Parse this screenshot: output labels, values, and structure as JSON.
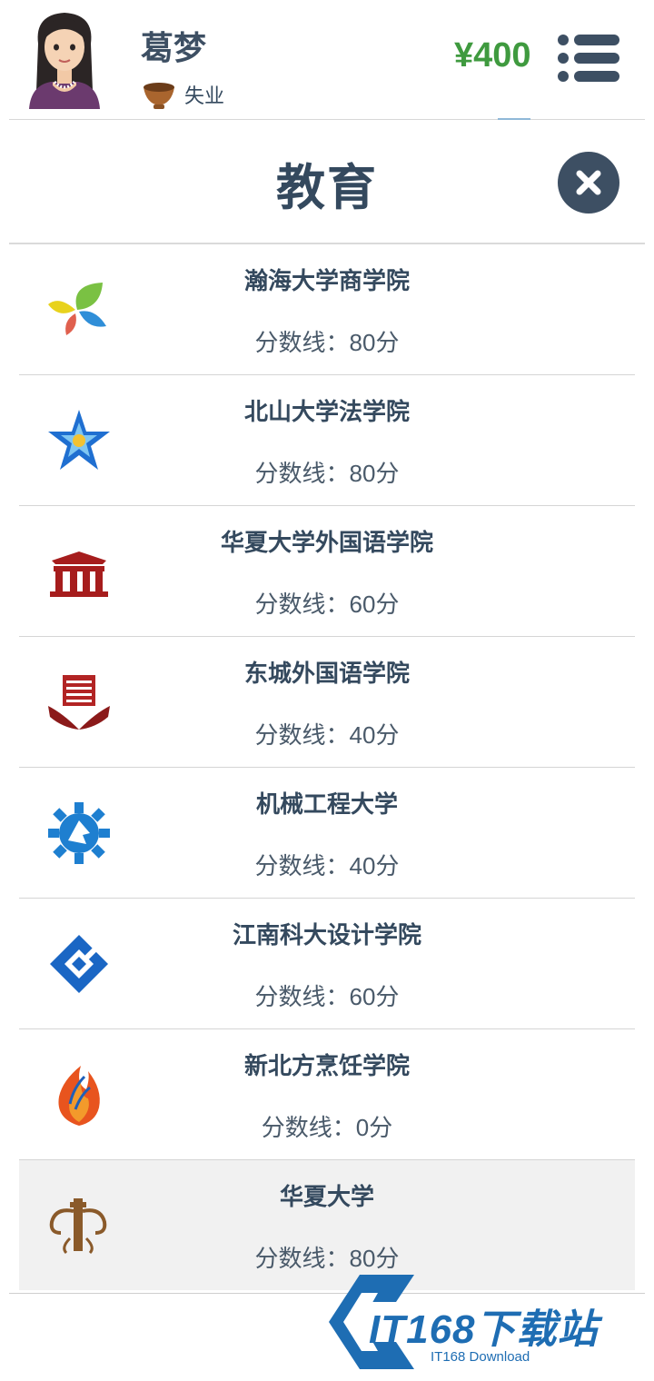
{
  "header": {
    "player_name": "葛梦",
    "status_label": "失业",
    "money": "¥400"
  },
  "title": "教育",
  "schools": [
    {
      "name": "瀚海大学商学院",
      "score": "分数线：80分",
      "logo": "clover-leaf-icon"
    },
    {
      "name": "北山大学法学院",
      "score": "分数线：80分",
      "logo": "star-flower-icon"
    },
    {
      "name": "华夏大学外国语学院",
      "score": "分数线：60分",
      "logo": "chinese-gate-icon"
    },
    {
      "name": "东城外国语学院",
      "score": "分数线：40分",
      "logo": "open-book-icon"
    },
    {
      "name": "机械工程大学",
      "score": "分数线：40分",
      "logo": "gear-icon"
    },
    {
      "name": "江南科大设计学院",
      "score": "分数线：60分",
      "logo": "diamond-icon"
    },
    {
      "name": "新北方烹饪学院",
      "score": "分数线：0分",
      "logo": "flame-icon"
    },
    {
      "name": "华夏大学",
      "score": "分数线：80分",
      "logo": "ornament-icon"
    }
  ],
  "colors": {
    "money": "#3f9a3f",
    "text_dark": "#34495e",
    "close_button": "#3d4f63",
    "watermark": "#1e6db3"
  },
  "watermark": {
    "title": "IT168下载站",
    "subtitle": "IT168 Download"
  }
}
